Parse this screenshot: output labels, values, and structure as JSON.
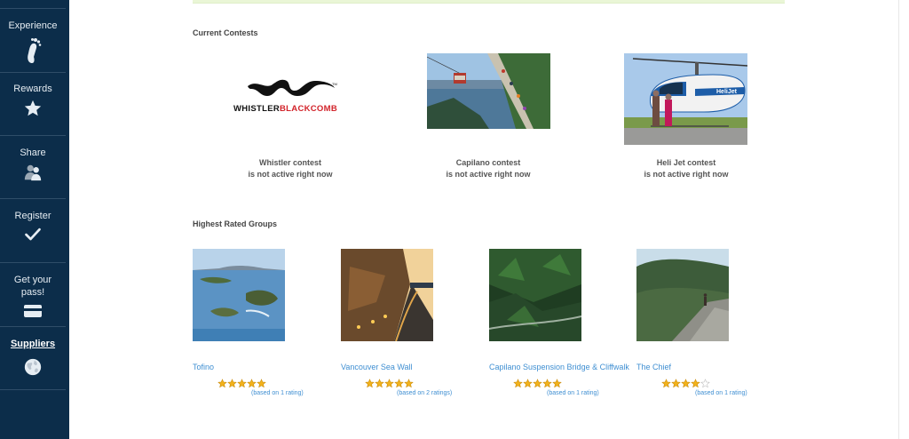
{
  "sidebar": {
    "items": [
      {
        "label": "Experience",
        "icon": "footprint-icon"
      },
      {
        "label": "Rewards",
        "icon": "star-icon"
      },
      {
        "label": "Share",
        "icon": "people-icon"
      },
      {
        "label": "Register",
        "icon": "checkmark-icon"
      },
      {
        "label": "Get your pass!",
        "icon": "card-icon"
      },
      {
        "label": "Suppliers",
        "icon": "globe-icon"
      }
    ]
  },
  "contests": {
    "title": "Current Contests",
    "items": [
      {
        "name": "Whistler contest",
        "status": "is not active right now",
        "logo_text_1": "WHISTLER",
        "logo_text_2": "BLACKCOMB"
      },
      {
        "name": "Capilano contest",
        "status": "is not active right now"
      },
      {
        "name": "Heli Jet contest",
        "status": "is not active right now",
        "logo_text": "HeliJet"
      }
    ]
  },
  "groups": {
    "title": "Highest Rated Groups",
    "items": [
      {
        "name": "Tofino",
        "rating": 5,
        "note": "(based on 1 rating)"
      },
      {
        "name": "Vancouver Sea Wall",
        "rating": 5,
        "note": "(based on 2 ratings)"
      },
      {
        "name": "Capilano Suspension Bridge & Cliffwalk",
        "rating": 5,
        "note": "(based on 1 rating)"
      },
      {
        "name": "The Chief",
        "rating": 4,
        "note": "(based on 1 rating)"
      }
    ]
  },
  "colors": {
    "sidebar": "#0c2d4a",
    "link": "#3f8fd2",
    "star": "#f2b21b"
  }
}
